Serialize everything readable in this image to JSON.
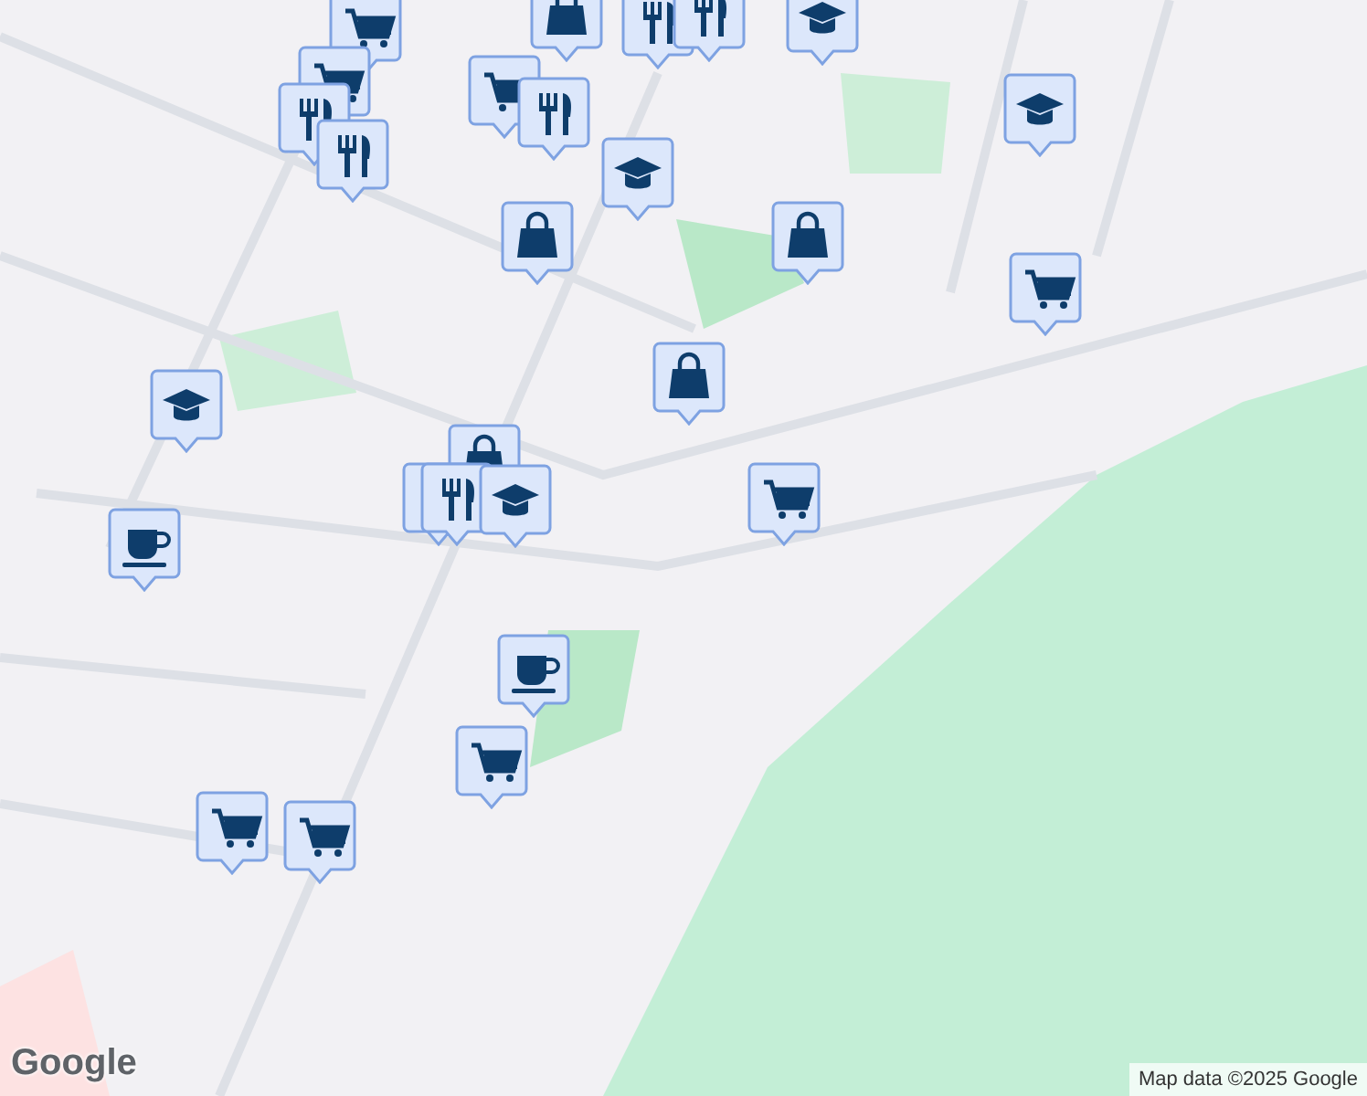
{
  "map": {
    "markers": [
      {
        "kind": "shop"
      },
      {
        "kind": "bag"
      },
      {
        "kind": "restaurant"
      },
      {
        "kind": "restaurant"
      },
      {
        "kind": "school"
      },
      {
        "kind": "shop"
      },
      {
        "kind": "shop"
      },
      {
        "kind": "restaurant"
      },
      {
        "kind": "restaurant"
      },
      {
        "kind": "restaurant"
      },
      {
        "kind": "school"
      },
      {
        "kind": "school"
      },
      {
        "kind": "bag"
      },
      {
        "kind": "bag"
      },
      {
        "kind": "shop"
      },
      {
        "kind": "bag"
      },
      {
        "kind": "school"
      },
      {
        "kind": "bag"
      },
      {
        "kind": "restaurant"
      },
      {
        "kind": "restaurant"
      },
      {
        "kind": "school"
      },
      {
        "kind": "shop"
      },
      {
        "kind": "cafe"
      },
      {
        "kind": "cafe"
      },
      {
        "kind": "shop"
      },
      {
        "kind": "shop"
      },
      {
        "kind": "shop"
      }
    ],
    "logo": "Google",
    "attribution": "Map data ©2025 Google"
  }
}
